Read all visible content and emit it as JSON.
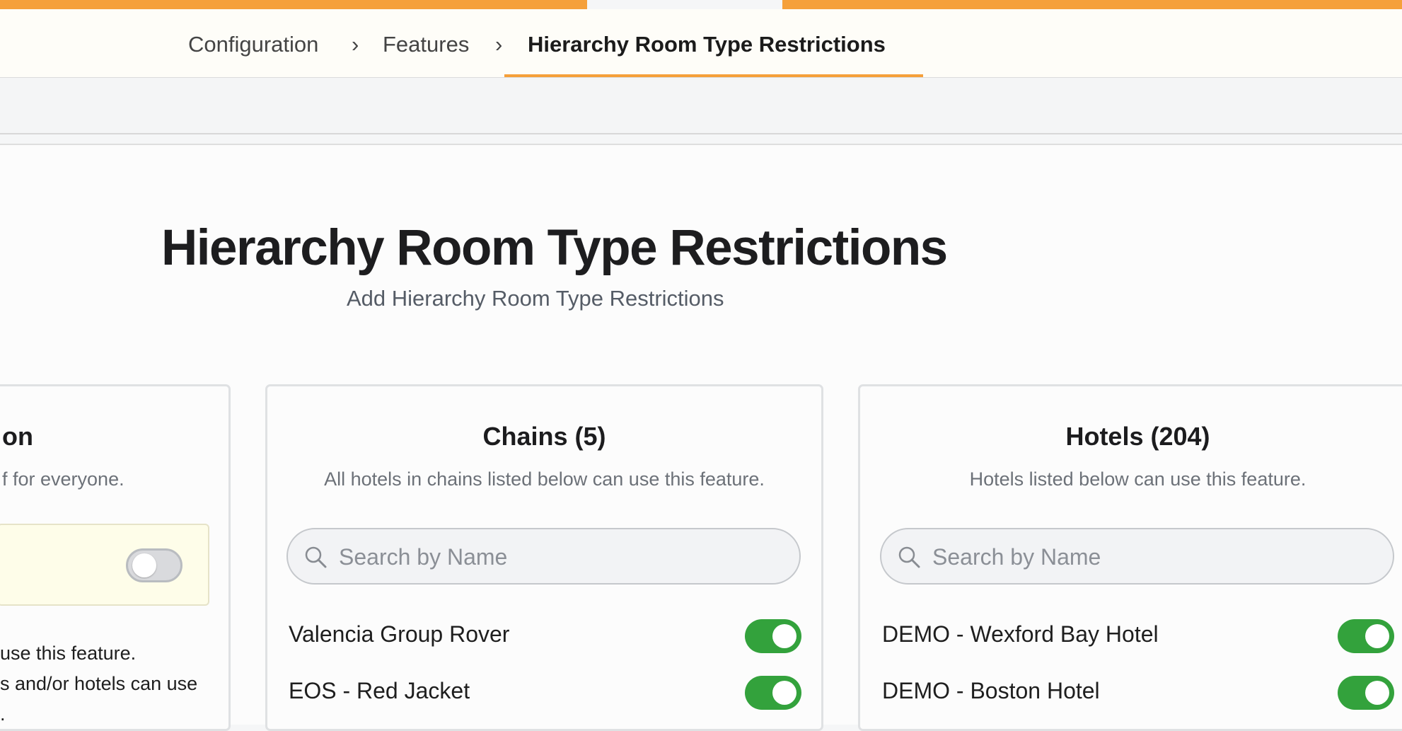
{
  "breadcrumb": {
    "items": [
      "Configuration",
      "Features",
      "Hierarchy Room Type Restrictions"
    ],
    "separator": "›"
  },
  "page": {
    "title": "Hierarchy Room Type Restrictions",
    "subtitle": "Add Hierarchy Room Type Restrictions"
  },
  "left_card": {
    "title_fragment": "on",
    "desc_fragment": "f for everyone.",
    "global_toggle": "off",
    "text_line1": "use this feature.",
    "text_line2": "s and/or hotels can use",
    "text_line3": "."
  },
  "chains_card": {
    "title": "Chains (5)",
    "description": "All hotels in chains listed below can use this feature.",
    "search_placeholder": "Search by Name",
    "items": [
      {
        "name": "Valencia Group Rover",
        "enabled": true
      },
      {
        "name": "EOS - Red Jacket",
        "enabled": true
      }
    ]
  },
  "hotels_card": {
    "title": "Hotels (204)",
    "description": "Hotels listed below can use this feature.",
    "search_placeholder": "Search by Name",
    "items": [
      {
        "name": "DEMO - Wexford Bay Hotel",
        "enabled": true
      },
      {
        "name": "DEMO - Boston Hotel",
        "enabled": true
      }
    ]
  },
  "colors": {
    "accent": "#f5a03a",
    "toggle_on": "#33a23c",
    "toggle_off": "#d9dadd"
  }
}
